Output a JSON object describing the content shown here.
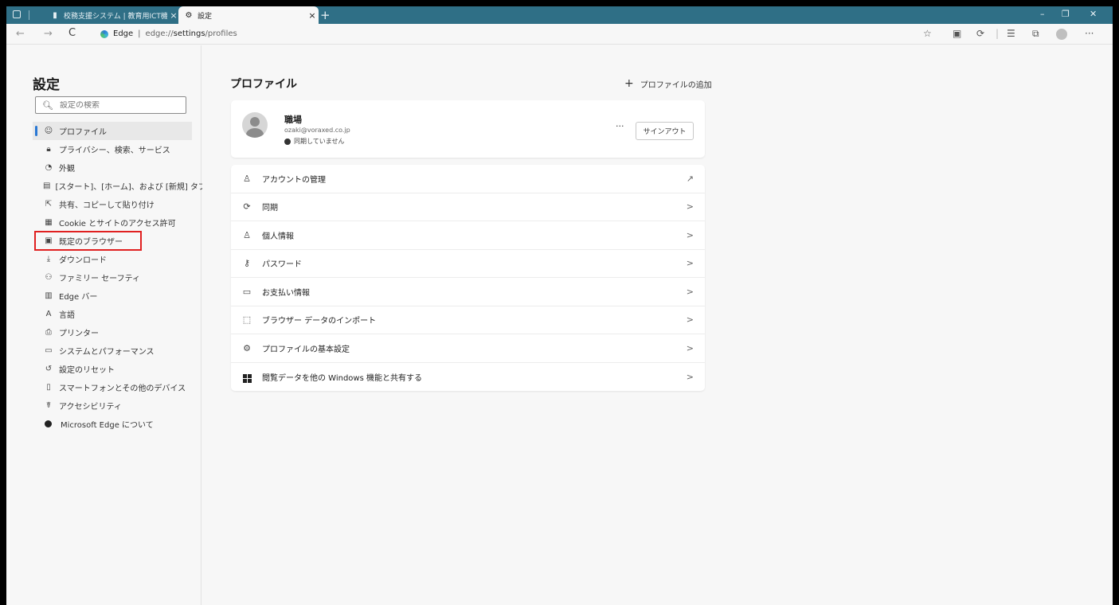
{
  "titlebar": {
    "tab1_title": "校務支援システム | 教育用ICT機器",
    "tab2_title": "設定",
    "close": "×",
    "new_tab": "+",
    "minimize": "–",
    "restore": "❐",
    "close_window": "✕"
  },
  "addressbar": {
    "back": "←",
    "forward": "→",
    "refresh": "C",
    "site": "Edge",
    "separator": "|",
    "url_prefix": "edge://",
    "url_bold": "settings",
    "url_suffix": "/profiles",
    "more": "···"
  },
  "sidebar": {
    "title": "設定",
    "search_placeholder": "設定の検索",
    "items": [
      {
        "label": "プロファイル",
        "icon": "profile-icon"
      },
      {
        "label": "プライバシー、検索、サービス",
        "icon": "lock-icon"
      },
      {
        "label": "外観",
        "icon": "appearance-icon"
      },
      {
        "label": "[スタート]、[ホーム]、および [新規] タブ",
        "icon": "start-home-icon"
      },
      {
        "label": "共有、コピーして貼り付け",
        "icon": "share-icon"
      },
      {
        "label": "Cookie とサイトのアクセス許可",
        "icon": "cookie-icon"
      },
      {
        "label": "既定のブラウザー",
        "icon": "default-browser-icon"
      },
      {
        "label": "ダウンロード",
        "icon": "download-icon"
      },
      {
        "label": "ファミリー セーフティ",
        "icon": "family-icon"
      },
      {
        "label": "Edge バー",
        "icon": "edge-bar-icon"
      },
      {
        "label": "言語",
        "icon": "language-icon"
      },
      {
        "label": "プリンター",
        "icon": "printer-icon"
      },
      {
        "label": "システムとパフォーマンス",
        "icon": "system-icon"
      },
      {
        "label": "設定のリセット",
        "icon": "reset-icon"
      },
      {
        "label": "スマートフォンとその他のデバイス",
        "icon": "phone-icon"
      },
      {
        "label": "アクセシビリティ",
        "icon": "accessibility-icon"
      },
      {
        "label": "Microsoft Edge について",
        "icon": "edge-logo-icon"
      }
    ]
  },
  "main": {
    "title": "プロファイル",
    "add_profile": "プロファイルの追加",
    "add_profile_plus": "+",
    "profile": {
      "name": "職場",
      "email": "ozaki@voraxed.co.jp",
      "sync_status": "同期していません",
      "more": "···",
      "signout": "サインアウト"
    },
    "rows": [
      {
        "label": "アカウントの管理",
        "icon": "account-icon",
        "trail": "↗"
      },
      {
        "label": "同期",
        "icon": "sync-icon",
        "trail": ">"
      },
      {
        "label": "個人情報",
        "icon": "personal-info-icon",
        "trail": ">"
      },
      {
        "label": "パスワード",
        "icon": "key-icon",
        "trail": ">"
      },
      {
        "label": "お支払い情報",
        "icon": "card-icon",
        "trail": ">"
      },
      {
        "label": "ブラウザー データのインポート",
        "icon": "import-icon",
        "trail": ">"
      },
      {
        "label": "プロファイルの基本設定",
        "icon": "profile-settings-icon",
        "trail": ">"
      },
      {
        "label": "閲覧データを他の Windows 機能と共有する",
        "icon": "windows-icon",
        "trail": ">"
      }
    ]
  }
}
